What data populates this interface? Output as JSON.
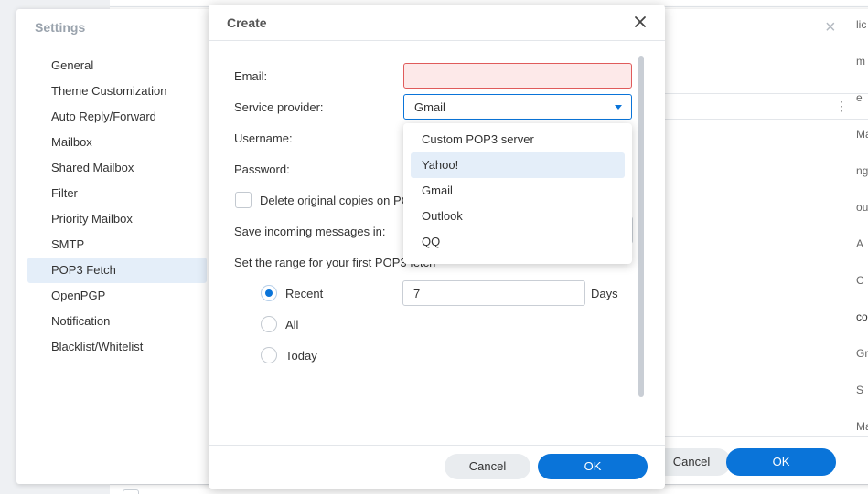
{
  "settings": {
    "title": "Settings",
    "close_glyph": "×",
    "items": [
      {
        "label": "General"
      },
      {
        "label": "Theme Customization"
      },
      {
        "label": "Auto Reply/Forward"
      },
      {
        "label": "Mailbox"
      },
      {
        "label": "Shared Mailbox"
      },
      {
        "label": "Filter"
      },
      {
        "label": "Priority Mailbox"
      },
      {
        "label": "SMTP"
      },
      {
        "label": "POP3 Fetch",
        "active": true
      },
      {
        "label": "OpenPGP"
      },
      {
        "label": "Notification"
      },
      {
        "label": "Blacklist/Whitelist"
      }
    ],
    "footer": {
      "cancel_label": "Cancel",
      "ok_label": "OK"
    },
    "more_glyph": "⋮",
    "right_fragments": [
      "lic",
      "m",
      "e",
      "Ma",
      "ng",
      "our",
      "A",
      "C",
      "co",
      "Gre",
      "S",
      "Ma"
    ]
  },
  "dialog": {
    "title": "Create",
    "email_label": "Email:",
    "email_value": "",
    "service_provider_label": "Service provider:",
    "service_provider_value": "Gmail",
    "username_label": "Username:",
    "password_label": "Password:",
    "delete_copies_label": "Delete original copies on POP3 server",
    "delete_copies_checked": false,
    "save_in_label": "Save incoming messages in:",
    "range_label": "Set the range for your first POP3 fetch",
    "range_options": [
      {
        "label": "Recent",
        "selected": true
      },
      {
        "label": "All",
        "selected": false
      },
      {
        "label": "Today",
        "selected": false
      }
    ],
    "days_value": "7",
    "days_unit": "Days",
    "provider_options": [
      {
        "label": "Custom POP3 server"
      },
      {
        "label": "Yahoo!",
        "highlighted": true
      },
      {
        "label": "Gmail"
      },
      {
        "label": "Outlook"
      },
      {
        "label": "QQ"
      }
    ],
    "cancel_label": "Cancel",
    "ok_label": "OK"
  },
  "colors": {
    "accent": "#0a74d9",
    "error_border": "#e05b5b",
    "error_fill": "#fde9e9",
    "selection": "#e4eef9"
  }
}
